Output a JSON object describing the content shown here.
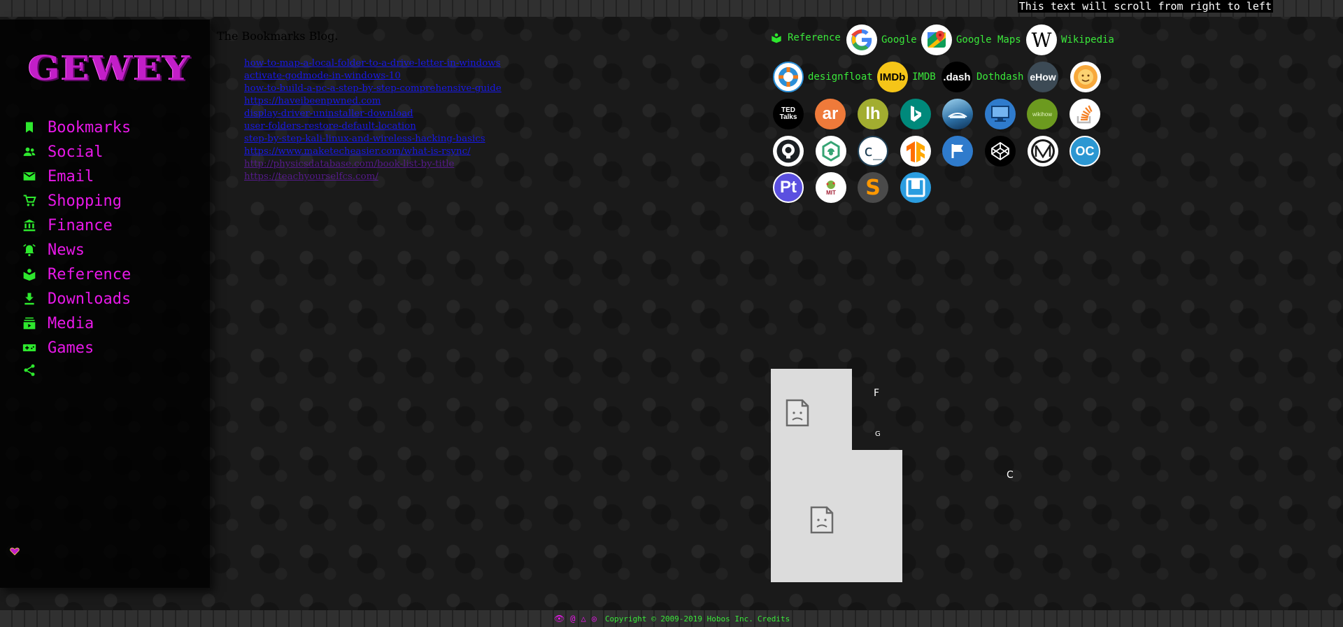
{
  "marquee": "This text will scroll from right to left",
  "logo_text": "GEWEY",
  "nav": [
    {
      "label": "Bookmarks",
      "icon": "bookmark-icon"
    },
    {
      "label": "Social",
      "icon": "people-icon"
    },
    {
      "label": "Email",
      "icon": "mail-icon"
    },
    {
      "label": "Shopping",
      "icon": "cart-icon"
    },
    {
      "label": "Finance",
      "icon": "bank-icon"
    },
    {
      "label": "News",
      "icon": "alarm-bell-icon"
    },
    {
      "label": "Reference",
      "icon": "book-icon"
    },
    {
      "label": "Downloads",
      "icon": "download-icon"
    },
    {
      "label": "Media",
      "icon": "media-stack-icon"
    },
    {
      "label": "Games",
      "icon": "gamepad-icon"
    },
    {
      "label": "",
      "icon": "share-icon"
    }
  ],
  "content_title": "The Bookmarks Blog.",
  "links": [
    {
      "text": "how-to-map-a-local-folder-to-a-drive-letter-in-windows",
      "visited": false
    },
    {
      "text": "activate-godmode-in-windows-10",
      "visited": false
    },
    {
      "text": "how-to-build-a-pc-a-step-by-step-comprehensive-guide",
      "visited": false
    },
    {
      "text": "https://haveibeenpwned.com",
      "visited": false
    },
    {
      "text": "display-driver-uninstaller-download",
      "visited": false
    },
    {
      "text": "user-folders-restore-default-location",
      "visited": false
    },
    {
      "text": "step-by-step-kali-linux-and-wireless-hacking-basics",
      "visited": false
    },
    {
      "text": "https://www.maketecheasier.com/what-is-rsync/",
      "visited": false
    },
    {
      "text": "http://physicsdatabase.com/book-list-by-title",
      "visited": true
    },
    {
      "text": "https://teachyourselfcs.com/",
      "visited": true
    }
  ],
  "reference": {
    "header_label": "Reference",
    "labeled": [
      {
        "label": "Google",
        "icon": "google-icon"
      },
      {
        "label": "Google Maps",
        "icon": "google-maps-icon"
      },
      {
        "label": "Wikipedia",
        "icon": "wikipedia-icon"
      },
      {
        "label": "designfloat",
        "icon": "lifebuoy-icon"
      },
      {
        "label": "IMDB",
        "icon": "imdb-icon"
      },
      {
        "label": "Dothdash",
        "icon": "dotdash-icon"
      }
    ],
    "tiles": [
      {
        "name": "ehow-icon",
        "text": "eHow"
      },
      {
        "name": "sun-face-icon",
        "text": ""
      },
      {
        "name": "ted-talks-icon",
        "text": "TED Talks"
      },
      {
        "name": "ar-icon",
        "text": "ar"
      },
      {
        "name": "lh-icon",
        "text": "lh"
      },
      {
        "name": "bing-icon",
        "text": ""
      },
      {
        "name": "photo-icon",
        "text": ""
      },
      {
        "name": "monitor-icon",
        "text": ""
      },
      {
        "name": "wikibooks-icon",
        "text": "wikihow"
      },
      {
        "name": "stackoverflow-icon",
        "text": ""
      },
      {
        "name": "github-icon",
        "text": ""
      },
      {
        "name": "hexagon-leaf-icon",
        "text": ""
      },
      {
        "name": "codecademy-icon",
        "text": "c_"
      },
      {
        "name": "tensorflow-icon",
        "text": "TF"
      },
      {
        "name": "flag-icon",
        "text": ""
      },
      {
        "name": "codepen-icon",
        "text": ""
      },
      {
        "name": "medium-icon",
        "text": ""
      },
      {
        "name": "opencollective-icon",
        "text": "OC"
      },
      {
        "name": "producthunt-icon",
        "text": "Pt"
      },
      {
        "name": "mit-icon",
        "text": "MIT"
      },
      {
        "name": "sublime-icon",
        "text": "S"
      },
      {
        "name": "bracket-box-icon",
        "text": ""
      }
    ]
  },
  "broken_letters": [
    "F",
    "G",
    "C"
  ],
  "footer": {
    "copyright": "Copyright © 2009-2019 Hobos Inc.",
    "credits": "Credits"
  },
  "colors": {
    "nav_text": "#e818e8",
    "nav_icon": "#2ee82e",
    "label_green": "#3ae83a",
    "link_blue": "#1818e6",
    "link_visited": "#551a8b"
  }
}
